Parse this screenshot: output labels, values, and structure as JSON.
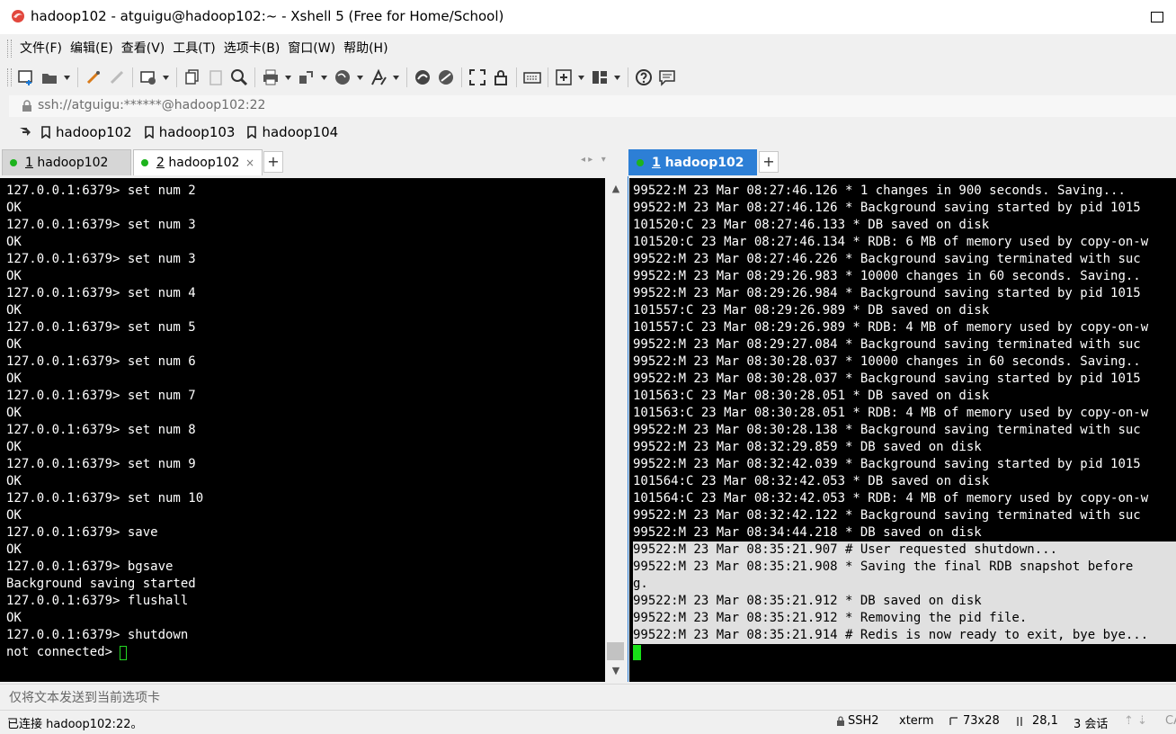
{
  "window": {
    "title": "hadoop102 - atguigu@hadoop102:~ - Xshell 5 (Free for Home/School)"
  },
  "menu": [
    "文件(F)",
    "编辑(E)",
    "查看(V)",
    "工具(T)",
    "选项卡(B)",
    "窗口(W)",
    "帮助(H)"
  ],
  "address": {
    "text": "ssh://atguigu:******@hadoop102:22"
  },
  "links": [
    "hadoop102",
    "hadoop103",
    "hadoop104"
  ],
  "tabs_left": [
    {
      "num": "1",
      "label": "hadoop102"
    },
    {
      "num": "2",
      "label": "hadoop102",
      "close": "×"
    }
  ],
  "tabs_right": [
    {
      "num": "1",
      "label": "hadoop102"
    }
  ],
  "tab_plus": "+",
  "terminal_left": {
    "lines": [
      "127.0.0.1:6379> set num 2",
      "OK",
      "127.0.0.1:6379> set num 3",
      "OK",
      "127.0.0.1:6379> set num 3",
      "OK",
      "127.0.0.1:6379> set num 4",
      "OK",
      "127.0.0.1:6379> set num 5",
      "OK",
      "127.0.0.1:6379> set num 6",
      "OK",
      "127.0.0.1:6379> set num 7",
      "OK",
      "127.0.0.1:6379> set num 8",
      "OK",
      "127.0.0.1:6379> set num 9",
      "OK",
      "127.0.0.1:6379> set num 10",
      "OK",
      "127.0.0.1:6379> save",
      "OK",
      "127.0.0.1:6379> bgsave",
      "Background saving started",
      "127.0.0.1:6379> flushall",
      "OK",
      "127.0.0.1:6379> shutdown"
    ],
    "prompt": "not connected> "
  },
  "terminal_right": {
    "lines": [
      "99522:M 23 Mar 08:27:46.126 * 1 changes in 900 seconds. Saving...",
      "99522:M 23 Mar 08:27:46.126 * Background saving started by pid 1015",
      "101520:C 23 Mar 08:27:46.133 * DB saved on disk",
      "101520:C 23 Mar 08:27:46.134 * RDB: 6 MB of memory used by copy-on-w",
      "99522:M 23 Mar 08:27:46.226 * Background saving terminated with suc",
      "99522:M 23 Mar 08:29:26.983 * 10000 changes in 60 seconds. Saving..",
      "99522:M 23 Mar 08:29:26.984 * Background saving started by pid 1015",
      "101557:C 23 Mar 08:29:26.989 * DB saved on disk",
      "101557:C 23 Mar 08:29:26.989 * RDB: 4 MB of memory used by copy-on-w",
      "99522:M 23 Mar 08:29:27.084 * Background saving terminated with suc",
      "99522:M 23 Mar 08:30:28.037 * 10000 changes in 60 seconds. Saving..",
      "99522:M 23 Mar 08:30:28.037 * Background saving started by pid 1015",
      "101563:C 23 Mar 08:30:28.051 * DB saved on disk",
      "101563:C 23 Mar 08:30:28.051 * RDB: 4 MB of memory used by copy-on-w",
      "99522:M 23 Mar 08:30:28.138 * Background saving terminated with suc",
      "99522:M 23 Mar 08:32:29.859 * DB saved on disk",
      "99522:M 23 Mar 08:32:42.039 * Background saving started by pid 1015",
      "101564:C 23 Mar 08:32:42.053 * DB saved on disk",
      "101564:C 23 Mar 08:32:42.053 * RDB: 4 MB of memory used by copy-on-w",
      "99522:M 23 Mar 08:32:42.122 * Background saving terminated with suc",
      "99522:M 23 Mar 08:34:44.218 * DB saved on disk"
    ],
    "highlighted_lines": [
      "99522:M 23 Mar 08:35:21.907 # User requested shutdown...",
      "99522:M 23 Mar 08:35:21.908 * Saving the final RDB snapshot before",
      "g.",
      "99522:M 23 Mar 08:35:21.912 * DB saved on disk",
      "99522:M 23 Mar 08:35:21.912 * Removing the pid file.",
      "99522:M 23 Mar 08:35:21.914 # Redis is now ready to exit, bye bye..."
    ]
  },
  "send_bar": {
    "text": "仅将文本发送到当前选项卡"
  },
  "status": {
    "connection": "已连接 hadoop102:22。",
    "protocol": "SSH2",
    "terminal": "xterm",
    "size": "73x28",
    "cursor": "28,1",
    "sessions": "3 会话",
    "caps": "CA"
  },
  "colors": {
    "terminal_bg": "#000000",
    "terminal_fg": "#ffffff",
    "active_tab": "#2d7fd6",
    "cursor": "#18e018",
    "status_dot": "#1db31d"
  }
}
